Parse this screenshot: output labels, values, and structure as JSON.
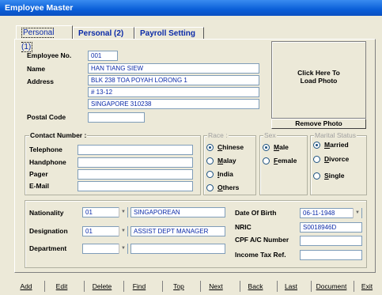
{
  "window": {
    "title": "Employee Master"
  },
  "tabs": [
    {
      "label": "Personal (1)"
    },
    {
      "label": "Personal (2)"
    },
    {
      "label": "Payroll Setting"
    }
  ],
  "personal": {
    "employee_no": {
      "label": "Employee No.",
      "value": "001"
    },
    "name": {
      "label": "Name",
      "value": "HAN TIANG SIEW"
    },
    "address": {
      "label": "Address",
      "line1": "BLK 238 TOA POYAH LORONG 1",
      "line2": "# 13-12",
      "line3": "SINGAPORE 310238"
    },
    "postal_code": {
      "label": "Postal Code",
      "value": ""
    }
  },
  "photo": {
    "load_label_1": "Click Here To",
    "load_label_2": "Load Photo",
    "remove_label": "Remove Photo"
  },
  "contact": {
    "title": "Contact Number :",
    "telephone": {
      "label": "Telephone",
      "value": ""
    },
    "handphone": {
      "label": "Handphone",
      "value": ""
    },
    "pager": {
      "label": "Pager",
      "value": ""
    },
    "email": {
      "label": "E-Mail",
      "value": ""
    }
  },
  "race": {
    "title": "Race :",
    "options": [
      "Chinese",
      "Malay",
      "India",
      "Others"
    ],
    "selected": "Chinese"
  },
  "sex": {
    "title": "Sex",
    "options": [
      "Male",
      "Female"
    ],
    "selected": "Male"
  },
  "marital": {
    "title": "Marital Status",
    "options": [
      "Married",
      "Divorce",
      "Single"
    ],
    "selected": "Married"
  },
  "details": {
    "nationality": {
      "label": "Nationality",
      "code": "01",
      "desc": "SINGAPOREAN"
    },
    "designation": {
      "label": "Designation",
      "code": "01",
      "desc": "ASSIST DEPT MANAGER"
    },
    "department": {
      "label": "Department",
      "code": "",
      "desc": ""
    },
    "dob": {
      "label": "Date Of Birth",
      "value": "06-11-1948"
    },
    "nric": {
      "label": "NRIC",
      "value": "S0018946D"
    },
    "cpf": {
      "label": "CPF A/C Number",
      "value": ""
    },
    "income_tax": {
      "label": "Income Tax Ref.",
      "value": ""
    }
  },
  "toolbar": {
    "add": "Add",
    "edit": "Edit",
    "delete": "Delete",
    "find": "Find",
    "top": "Top",
    "next": "Next",
    "back": "Back",
    "last": "Last",
    "document": "Document",
    "exit": "Exit"
  },
  "colors": {
    "title_bar": "#0a5fd8",
    "field_text": "#0b2aa8",
    "background": "#ece9d8"
  }
}
